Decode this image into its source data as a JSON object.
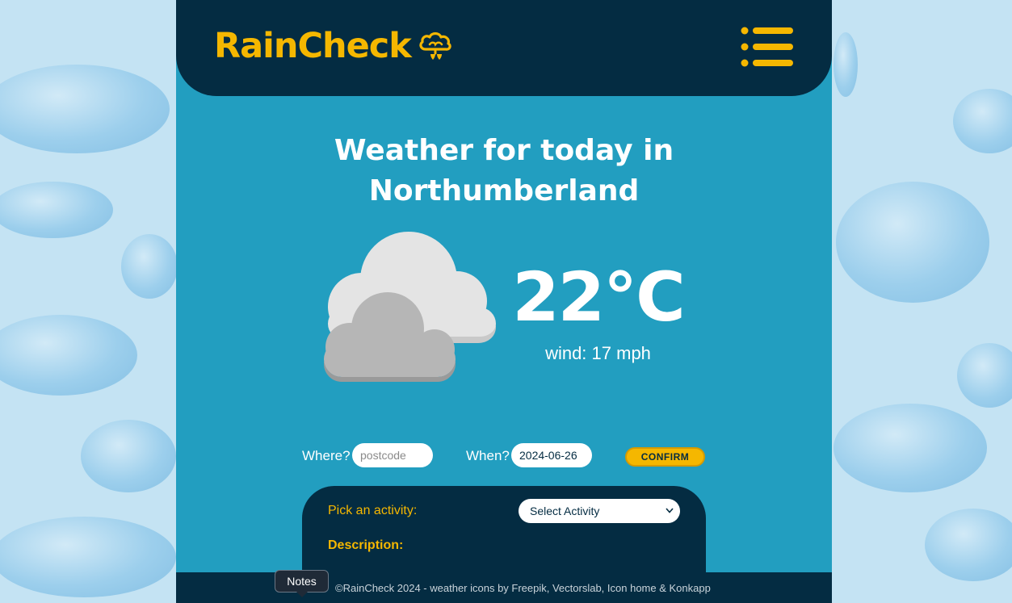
{
  "app": {
    "brand": "RainCheck",
    "brand_color": "#f5b700",
    "header_color": "#042c42",
    "main_color": "#229ec0"
  },
  "header": {
    "logo_icon": "cloud-rain-icon",
    "menu_icon": "hamburger-menu-icon"
  },
  "weather": {
    "title_line1": "Weather for today in",
    "title_line2": "Northumberland",
    "icon": "partly-cloudy-icon",
    "temperature": "22°C",
    "wind": "wind: 17 mph"
  },
  "form": {
    "where_label": "Where?",
    "where_placeholder": "postcode",
    "where_value": "",
    "when_label": "When?",
    "when_value": "2024-06-26",
    "confirm_label": "CONFIRM"
  },
  "activity": {
    "pick_label": "Pick an activity:",
    "select_value": "Select Activity",
    "description_label": "Description:"
  },
  "footer": {
    "text": "©RainCheck 2024 - weather icons by Freepik, Vectorslab, Icon home & Konkapp"
  },
  "tooltip": {
    "label": "Notes"
  }
}
